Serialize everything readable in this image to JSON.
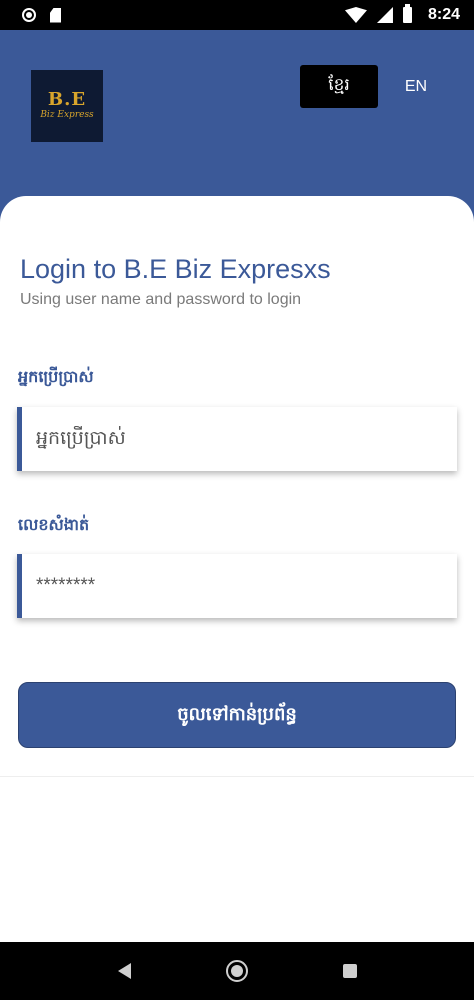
{
  "status_bar": {
    "time": "8:24"
  },
  "header": {
    "logo_line1": "B.E",
    "logo_line2": "Biz Express",
    "lang_khmer": "ខ្មែរ",
    "lang_english": "EN"
  },
  "login": {
    "title": "Login to B.E Biz Expresxs",
    "subtitle": "Using user name and password to login",
    "username_label": "អ្នកប្រើប្រាស់",
    "username_placeholder": "អ្នកប្រើប្រាស់",
    "password_label": "លេខសំងាត់",
    "password_value": "********",
    "submit_label": "ចូលទៅកាន់ប្រព័ន្ធ"
  },
  "colors": {
    "brand": "#3b5998",
    "logo_bg": "#0e1a33",
    "logo_gold": "#d8a52c"
  }
}
